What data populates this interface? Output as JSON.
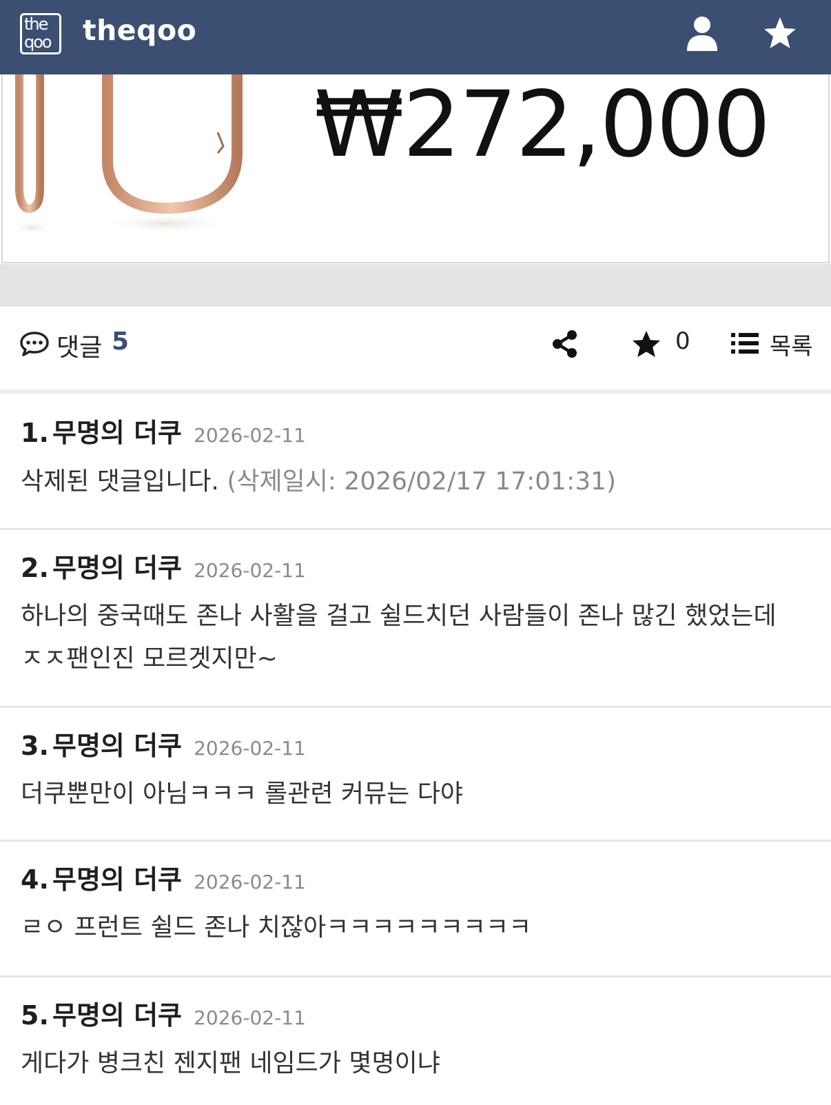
{
  "header": {
    "logo_line1": "the",
    "logo_line2": "qoo",
    "site_name": "theqoo"
  },
  "product": {
    "price": "₩272,000"
  },
  "toolbar": {
    "comment_label": "댓글",
    "comment_count": "5",
    "star_count": "0",
    "list_label": "목록"
  },
  "comments": [
    {
      "number": "1.",
      "author": "무명의 더쿠",
      "date": "2026-02-11",
      "text": "삭제된 댓글입니다.",
      "note": "(삭제일시: 2026/02/17 17:01:31)"
    },
    {
      "number": "2.",
      "author": "무명의 더쿠",
      "date": "2026-02-11",
      "text": "하나의 중국때도 존나 사활을 걸고 쉴드치던 사람들이 존나 많긴 했었는데 ㅈㅈ팬인진 모르겟지만~"
    },
    {
      "number": "3.",
      "author": "무명의 더쿠",
      "date": "2026-02-11",
      "text": "더쿠뿐만이 아님ㅋㅋㅋ 롤관련 커뮤는 다야"
    },
    {
      "number": "4.",
      "author": "무명의 더쿠",
      "date": "2026-02-11",
      "text": "ㄹㅇ 프런트 쉴드 존나 치잖아ㅋㅋㅋㅋㅋㅋㅋㅋㅋ"
    },
    {
      "number": "5.",
      "author": "무명의 더쿠",
      "date": "2026-02-11",
      "text": "게다가 병크친 젠지팬 네임드가 몇명이냐"
    }
  ]
}
